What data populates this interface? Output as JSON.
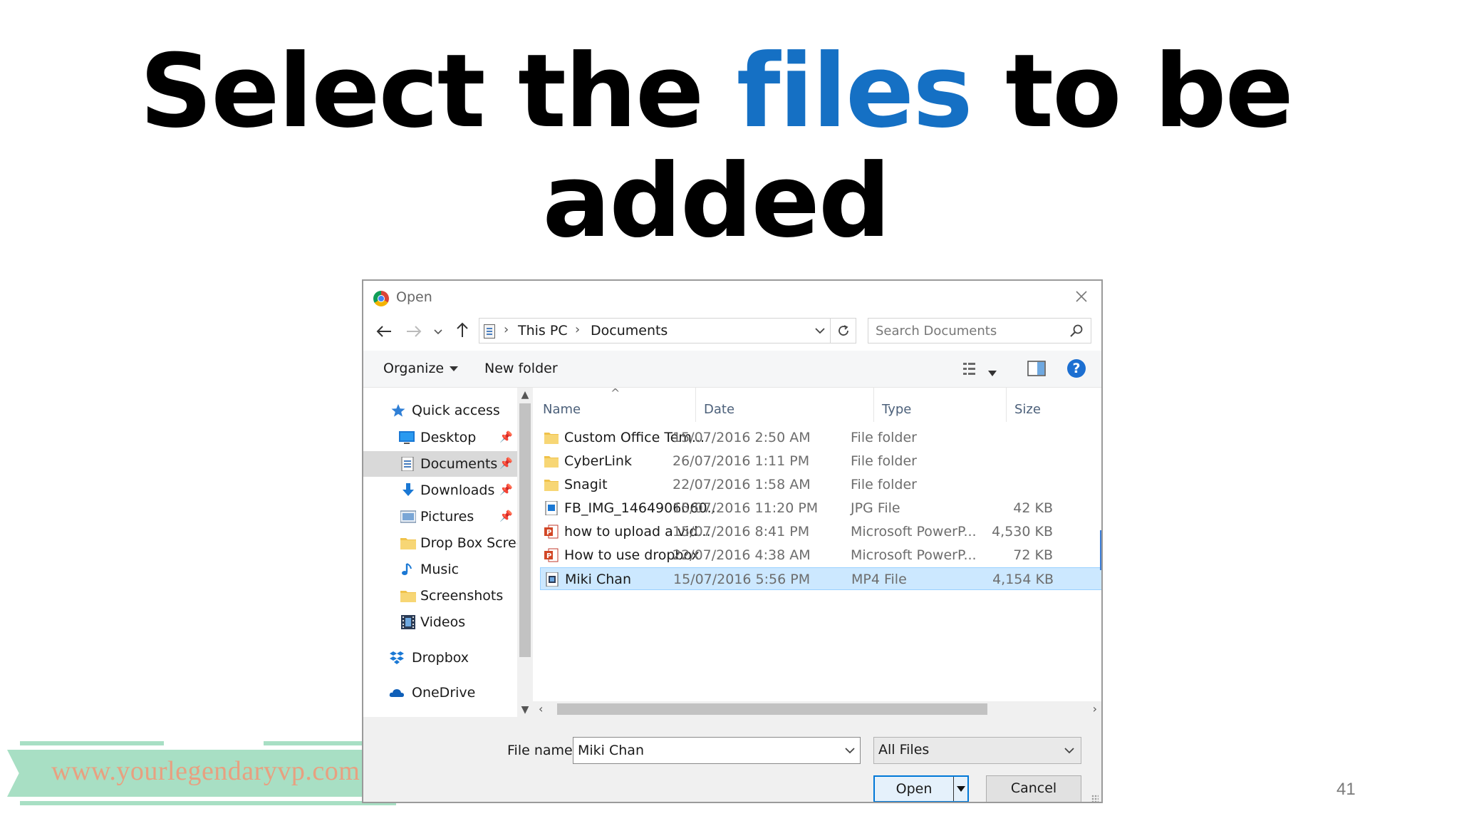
{
  "slide": {
    "title_part1": "Select the ",
    "title_accent": "files",
    "title_part2": " to be",
    "title_line2": "added",
    "accent_color": "#1570c4",
    "page_number": "41",
    "watermark": "www.yourlegendaryvp.com"
  },
  "dialog": {
    "title": "Open",
    "app_icon": "chrome-icon",
    "address": {
      "parts": [
        "This PC",
        "Documents"
      ]
    },
    "search": {
      "placeholder": "Search Documents"
    },
    "commands": {
      "organize": "Organize",
      "new_folder": "New folder"
    },
    "nav": {
      "items": [
        {
          "label": "Quick access",
          "icon": "star-icon",
          "pinned": false
        },
        {
          "label": "Desktop",
          "icon": "desktop-icon",
          "pinned": true
        },
        {
          "label": "Documents",
          "icon": "documents-icon",
          "pinned": true,
          "selected": true
        },
        {
          "label": "Downloads",
          "icon": "download-arrow-icon",
          "pinned": true
        },
        {
          "label": "Pictures",
          "icon": "pictures-icon",
          "pinned": true
        },
        {
          "label": "Drop Box Screen",
          "icon": "folder-icon",
          "pinned": false
        },
        {
          "label": "Music",
          "icon": "music-note-icon",
          "pinned": false
        },
        {
          "label": "Screenshots",
          "icon": "folder-icon",
          "pinned": false
        },
        {
          "label": "Videos",
          "icon": "film-icon",
          "pinned": false
        },
        {
          "label": "Dropbox",
          "icon": "dropbox-icon",
          "pinned": false
        },
        {
          "label": "OneDrive",
          "icon": "cloud-icon",
          "pinned": false
        }
      ]
    },
    "columns": {
      "name": "Name",
      "date": "Date",
      "type": "Type",
      "size": "Size"
    },
    "files": [
      {
        "name": "Custom Office Tem...",
        "date": "15/07/2016 2:50 AM",
        "type": "File folder",
        "size": "",
        "icon": "folder-icon"
      },
      {
        "name": "CyberLink",
        "date": "26/07/2016 1:11 PM",
        "type": "File folder",
        "size": "",
        "icon": "folder-icon"
      },
      {
        "name": "Snagit",
        "date": "22/07/2016 1:58 AM",
        "type": "File folder",
        "size": "",
        "icon": "folder-icon"
      },
      {
        "name": "FB_IMG_1464906060...",
        "date": "15/07/2016 11:20 PM",
        "type": "JPG File",
        "size": "42 KB",
        "icon": "image-file-icon"
      },
      {
        "name": "how to upload a vid...",
        "date": "15/07/2016 8:41 PM",
        "type": "Microsoft PowerP...",
        "size": "4,530 KB",
        "icon": "powerpoint-icon"
      },
      {
        "name": "How to use dropbox",
        "date": "22/07/2016 4:38 AM",
        "type": "Microsoft PowerP...",
        "size": "72 KB",
        "icon": "powerpoint-icon"
      },
      {
        "name": "Miki Chan",
        "date": "15/07/2016 5:56 PM",
        "type": "MP4 File",
        "size": "4,154 KB",
        "icon": "video-file-icon",
        "selected": true
      }
    ],
    "footer": {
      "file_name_label": "File name:",
      "file_name_value": "Miki Chan",
      "file_type": "All Files",
      "open_label": "Open",
      "cancel_label": "Cancel"
    }
  }
}
